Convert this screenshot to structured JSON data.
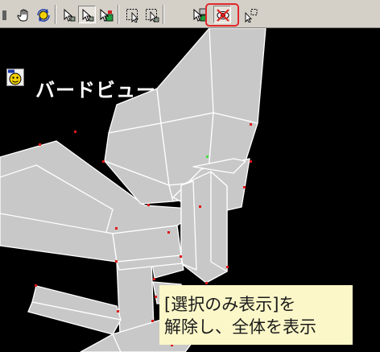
{
  "toolbar": {
    "buttons": [
      {
        "name": "hand-pan-icon"
      },
      {
        "name": "rotate-view-icon"
      },
      {
        "name": "select-pointer-icon"
      },
      {
        "name": "select-pointer-alt-icon",
        "pressed": true
      },
      {
        "name": "select-colored-icon"
      },
      {
        "name": "select-region-icon"
      },
      {
        "name": "select-region-alt-icon"
      },
      {
        "name": "select-group-icon"
      },
      {
        "name": "show-selected-only-icon",
        "highlighted": true
      },
      {
        "name": "move-pointer-icon"
      }
    ],
    "highlight_color": "#e3262a"
  },
  "viewport": {
    "title": "バードビュー",
    "background": "#000000",
    "icon": "bird-view-icon"
  },
  "note": {
    "line1": "[選択のみ表示]を",
    "line2": "解除し、全体を表示",
    "background": "#fbf7c8"
  },
  "colors": {
    "model_face": "#c8c8c8",
    "model_edge": "#ffffff",
    "vertex": "#e01818"
  }
}
